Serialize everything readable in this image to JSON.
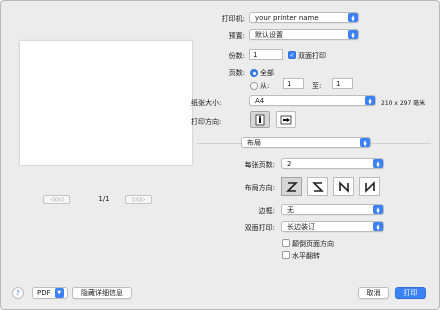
{
  "printer": {
    "label": "打印机:",
    "value": "your printer name"
  },
  "presets": {
    "label": "预置:",
    "value": "默认设置"
  },
  "copies": {
    "label": "份数:",
    "value": "1",
    "two_sided_label": "双面打印",
    "two_sided_checked": true
  },
  "pages": {
    "label": "页数:",
    "all_label": "全部",
    "from_label": "从:",
    "from_value": "1",
    "to_label": "至:",
    "to_value": "1",
    "selected": "all"
  },
  "paper_size": {
    "label": "纸张大小:",
    "value": "A4",
    "dimensions": "210 x 297 毫米"
  },
  "orientation": {
    "label": "打印方向:",
    "selected": "portrait"
  },
  "section": {
    "value": "布局"
  },
  "layout": {
    "pages_per_sheet_label": "每张页数:",
    "pages_per_sheet_value": "2",
    "direction_label": "布局方向:",
    "direction_selected": 0,
    "border_label": "边框:",
    "border_value": "无",
    "two_sided_label": "双面打印:",
    "two_sided_value": "长边装订",
    "reverse_orientation_label": "颠倒页面方向",
    "flip_horizontal_label": "水平翻转"
  },
  "preview": {
    "page_indicator": "1/1",
    "prev_glyph": "◁◁ ◁",
    "next_glyph": "▷ ▷▷"
  },
  "footer": {
    "help_glyph": "?",
    "pdf_label": "PDF",
    "hide_details_label": "隐藏详细信息",
    "cancel_label": "取消",
    "print_label": "打印"
  },
  "colors": {
    "accent": "#3b82f6",
    "background": "#ececec"
  },
  "icons": {
    "popup_arrow": "up-down-chevron-icon",
    "portrait": "portrait-orientation-icon",
    "landscape": "landscape-orientation-icon"
  }
}
